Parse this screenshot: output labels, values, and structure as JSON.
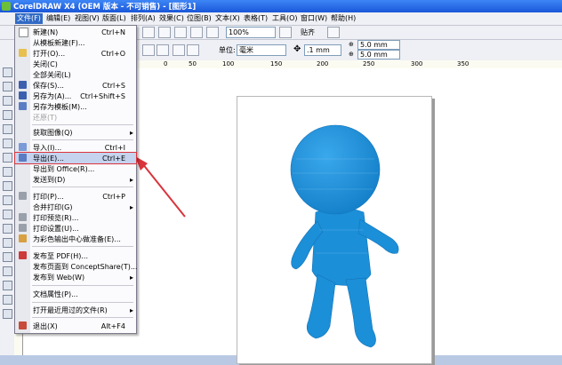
{
  "titlebar": {
    "title": "CorelDRAW X4 (OEM 版本 - 不可销售) - [图形1]"
  },
  "menubar": {
    "items": [
      "文件(F)",
      "编辑(E)",
      "视图(V)",
      "版面(L)",
      "排列(A)",
      "效果(C)",
      "位图(B)",
      "文本(X)",
      "表格(T)",
      "工具(O)",
      "窗口(W)",
      "帮助(H)"
    ]
  },
  "toolbar": {
    "zoom": "100%",
    "snap": "贴齐",
    "unit_label": "单位:",
    "unit_value": "毫米",
    "nudge_value": ".1 mm",
    "dup_x": "5.0 mm",
    "dup_y": "5.0 mm"
  },
  "ruler": {
    "numbers": [
      "50",
      "0",
      "50",
      "100",
      "150",
      "200",
      "250",
      "300",
      "350"
    ]
  },
  "file_menu": {
    "items": [
      {
        "label": "新建(N)",
        "shortcut": "Ctrl+N"
      },
      {
        "label": "从模板新建(F)..."
      },
      {
        "label": "打开(O)...",
        "shortcut": "Ctrl+O"
      },
      {
        "label": "关闭(C)"
      },
      {
        "label": "全部关闭(L)"
      },
      {
        "label": "保存(S)...",
        "shortcut": "Ctrl+S"
      },
      {
        "label": "另存为(A)...",
        "shortcut": "Ctrl+Shift+S"
      },
      {
        "label": "另存为模板(M)..."
      },
      {
        "label": "还原(T)"
      },
      {
        "label": "获取图像(Q)"
      },
      {
        "label": "导入(I)...",
        "shortcut": "Ctrl+I"
      },
      {
        "label": "导出(E)...",
        "shortcut": "Ctrl+E"
      },
      {
        "label": "导出到 Office(R)..."
      },
      {
        "label": "发送到(D)"
      },
      {
        "label": "打印(P)...",
        "shortcut": "Ctrl+P"
      },
      {
        "label": "合并打印(G)"
      },
      {
        "label": "打印预览(R)..."
      },
      {
        "label": "打印设置(U)..."
      },
      {
        "label": "为彩色输出中心做准备(E)..."
      },
      {
        "label": "发布至 PDF(H)..."
      },
      {
        "label": "发布页面到 ConceptShare(T)..."
      },
      {
        "label": "发布到 Web(W)"
      },
      {
        "label": "文档属性(P)..."
      },
      {
        "label": "打开最近用过的文件(R)"
      },
      {
        "label": "退出(X)",
        "shortcut": "Alt+F4"
      }
    ]
  },
  "colors": {
    "accent": "#316ac5",
    "figure": "#1b8fd8",
    "arrow": "#d9343c"
  }
}
